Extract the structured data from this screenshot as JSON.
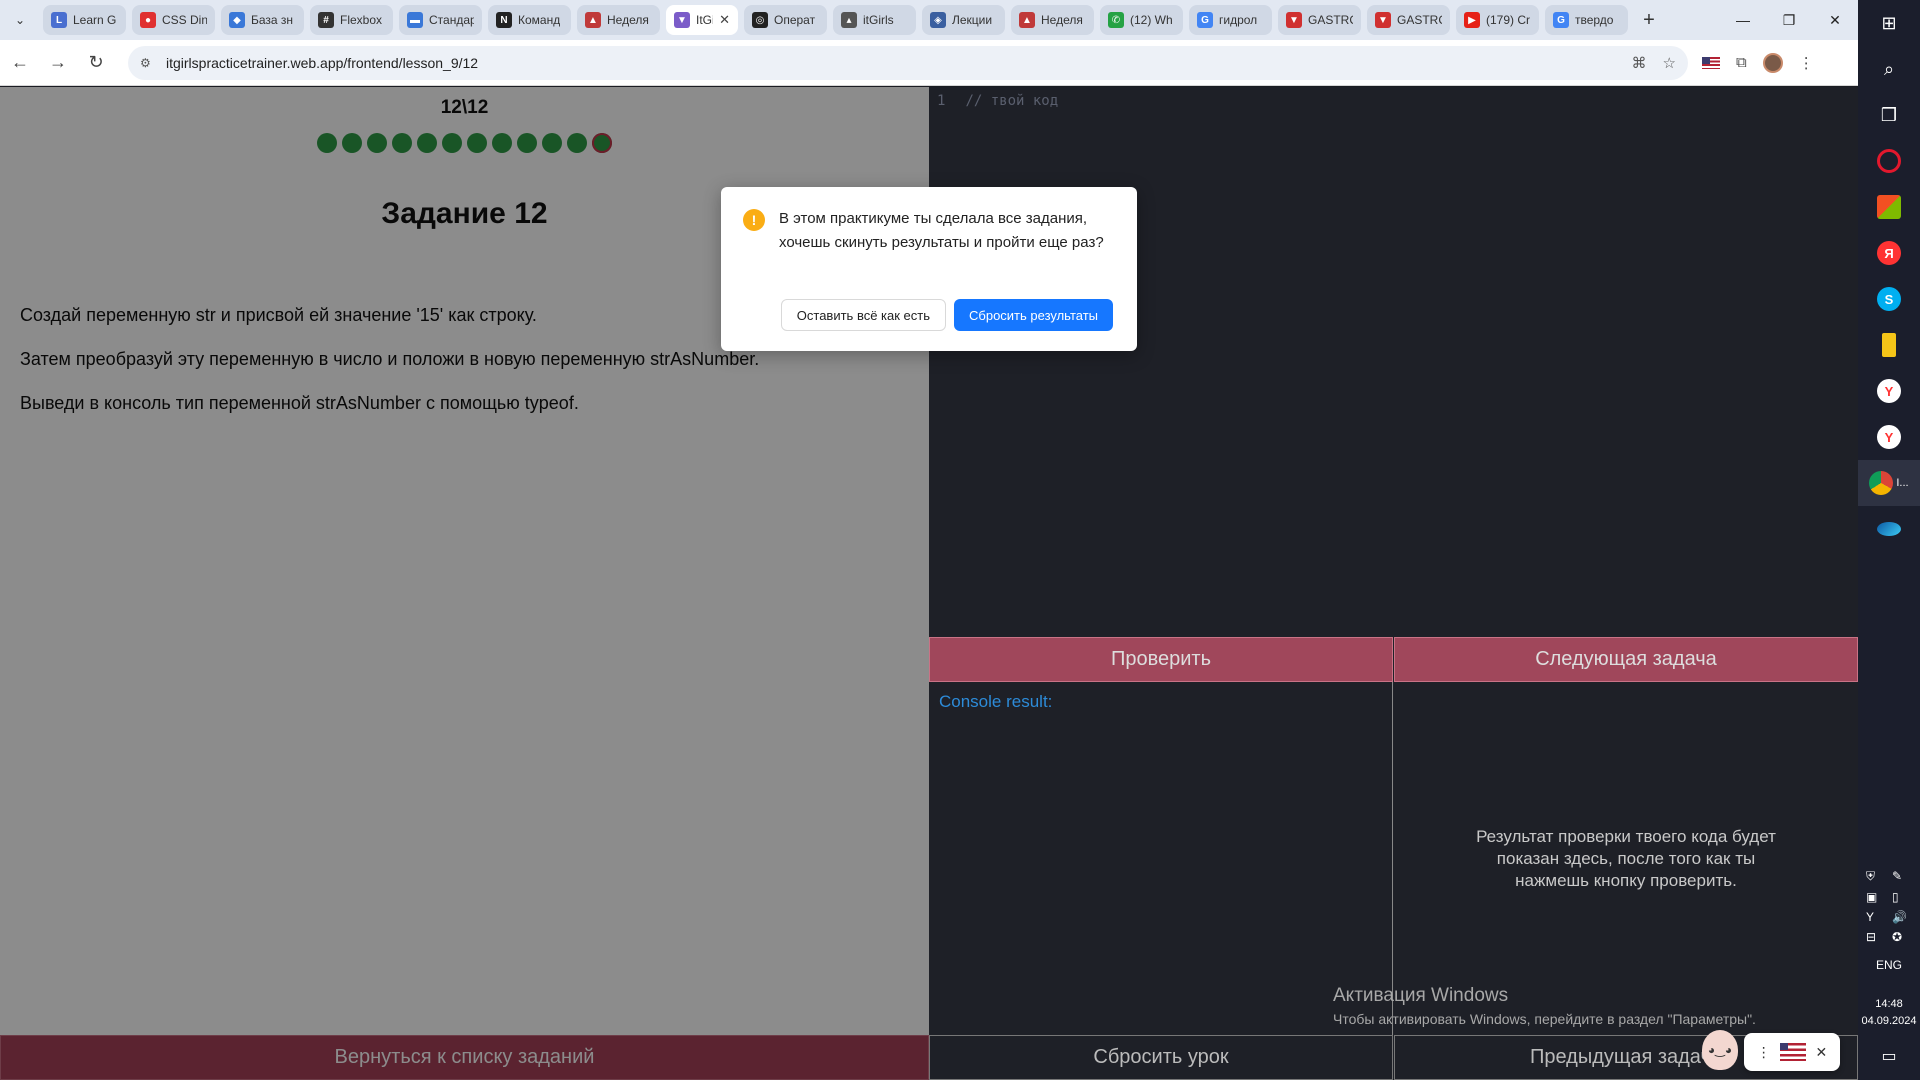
{
  "browser": {
    "tabs": [
      {
        "title": "Learn G",
        "color": "#4a6fd0",
        "glyph": "L"
      },
      {
        "title": "CSS Din",
        "color": "#e03030",
        "glyph": "●"
      },
      {
        "title": "База зн",
        "color": "#3a78d8",
        "glyph": "◆"
      },
      {
        "title": "Flexbox",
        "color": "#333333",
        "glyph": "#"
      },
      {
        "title": "Стандар",
        "color": "#3a78d8",
        "glyph": "▬"
      },
      {
        "title": "Команд",
        "color": "#222222",
        "glyph": "N"
      },
      {
        "title": "Неделя",
        "color": "#c03a3a",
        "glyph": "▲"
      },
      {
        "title": "ItGi",
        "color": "#7b5cc9",
        "glyph": "▼",
        "active": true
      },
      {
        "title": "Операт",
        "color": "#222222",
        "glyph": "◎"
      },
      {
        "title": "itGirls",
        "color": "#555555",
        "glyph": "▴"
      },
      {
        "title": "Лекции",
        "color": "#3a5fa0",
        "glyph": "◈"
      },
      {
        "title": "Неделя",
        "color": "#c03a3a",
        "glyph": "▲"
      },
      {
        "title": "(12) Wh",
        "color": "#25a244",
        "glyph": "✆"
      },
      {
        "title": "гидрол",
        "color": "#4285f4",
        "glyph": "G"
      },
      {
        "title": "GASTRC",
        "color": "#d03030",
        "glyph": "▼"
      },
      {
        "title": "GASTRC",
        "color": "#d03030",
        "glyph": "▼"
      },
      {
        "title": "(179) Cr",
        "color": "#e62117",
        "glyph": "▶"
      },
      {
        "title": "твердо",
        "color": "#4285f4",
        "glyph": "G"
      }
    ],
    "tab_close": "✕",
    "new_tab": "+",
    "url": "itgirlspracticetrainer.web.app/frontend/lesson_9/12",
    "win_minimize": "—",
    "win_restore": "❐",
    "win_close": "✕"
  },
  "lesson": {
    "counter": "12\\12",
    "progress": {
      "total": 12,
      "completed": 12,
      "current": 12
    },
    "title": "Задание 12",
    "paragraphs": [
      "Создай переменную str и присвой ей значение '15' как строку.",
      "Затем преобразуй эту переменную в число и положи в новую переменную strAsNumber.",
      "Выведи в консоль тип переменной strAsNumber с помощью typeof."
    ],
    "back_button": "Вернуться к списку заданий"
  },
  "editor": {
    "line_number": "1",
    "placeholder_code": "// твой код",
    "check_button": "Проверить",
    "next_button": "Следующая задача",
    "console_label": "Console result:",
    "result_hint": "Результат проверки твоего кода будет показан здесь, после того как ты нажмешь кнопку проверить.",
    "reset_button": "Сбросить урок",
    "prev_button": "Предыдущая задача"
  },
  "modal": {
    "icon": "!",
    "message": "В этом практикуме ты сделала все задания, хочешь скинуть результаты и пройти еще раз?",
    "keep_button": "Оставить всё как есть",
    "reset_button": "Сбросить результаты",
    "colors": {
      "warning": "#faad14",
      "primary": "#1677ff"
    }
  },
  "watermark": {
    "title": "Активация Windows",
    "subtitle": "Чтобы активировать Windows, перейдите в раздел \"Параметры\"."
  },
  "taskbar": {
    "language": "ENG",
    "time": "14:48",
    "date": "04.09.2024",
    "active_app_label": "I..."
  },
  "colors": {
    "done_dot": "#2f9c46",
    "action_button": "#a64058",
    "console_label": "#2d8bd8"
  }
}
